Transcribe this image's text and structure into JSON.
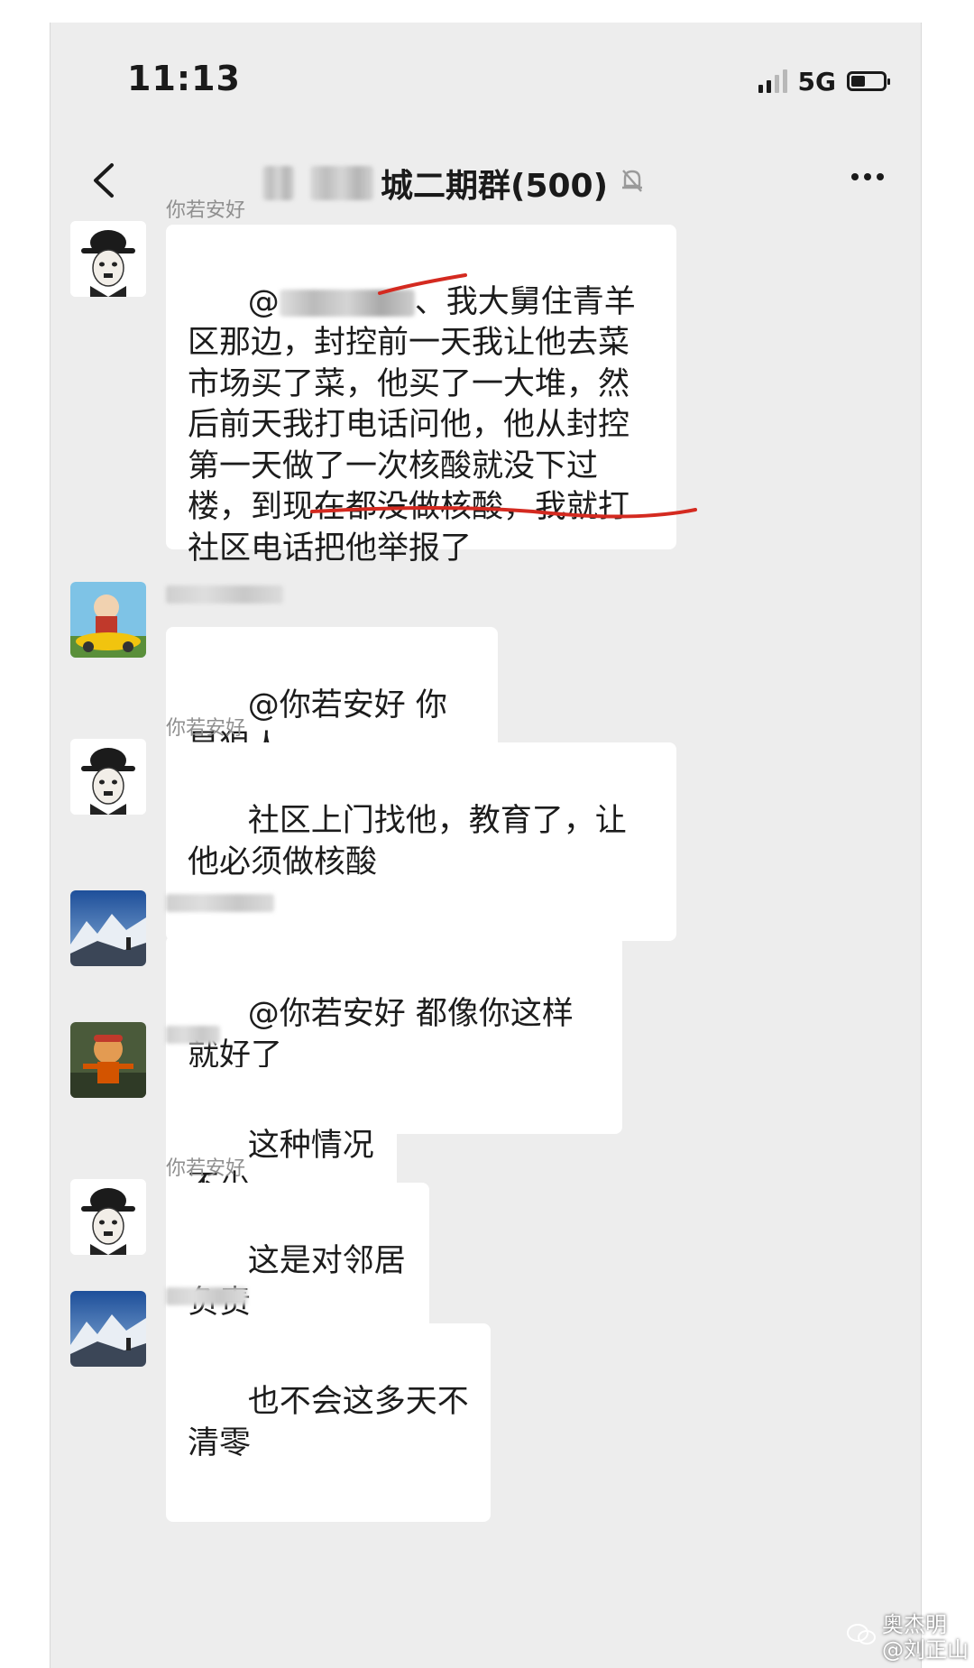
{
  "status_bar": {
    "time": "11:13",
    "network": "5G",
    "battery_level": 0.45
  },
  "nav": {
    "back_icon": "back-chevron-icon",
    "title": "城二期群(500)",
    "more_icon": "more-icon"
  },
  "messages": [
    {
      "sender": "你若安好",
      "avatar": "chaplin",
      "text_prefix": "@",
      "text_after_mention": "、我大舅住青羊区那边，封控前一天我让他去菜市场买了菜，他买了一大堆，然后前天我打电话问他，他从封控第一天做了一次核酸就没下过楼，到现在都没做核酸，我就打社区电话把他举报了"
    },
    {
      "sender": "",
      "avatar": "cartoon-car",
      "text": "@你若安好 你是狠人"
    },
    {
      "sender": "你若安好",
      "avatar": "chaplin",
      "text": "社区上门找他，教育了，让他必须做核酸"
    },
    {
      "sender": "",
      "avatar": "mountain",
      "text": "@你若安好 都像你这样就好了"
    },
    {
      "sender": "",
      "avatar": "cartoon-figure",
      "text": "这种情况不少"
    },
    {
      "sender": "你若安好",
      "avatar": "chaplin",
      "text": "这是对邻居负责"
    },
    {
      "sender": "",
      "avatar": "mountain",
      "text": "也不会这多天不清零"
    }
  ],
  "watermark": {
    "line1": "奥杰明",
    "line2": "@刘正山"
  }
}
